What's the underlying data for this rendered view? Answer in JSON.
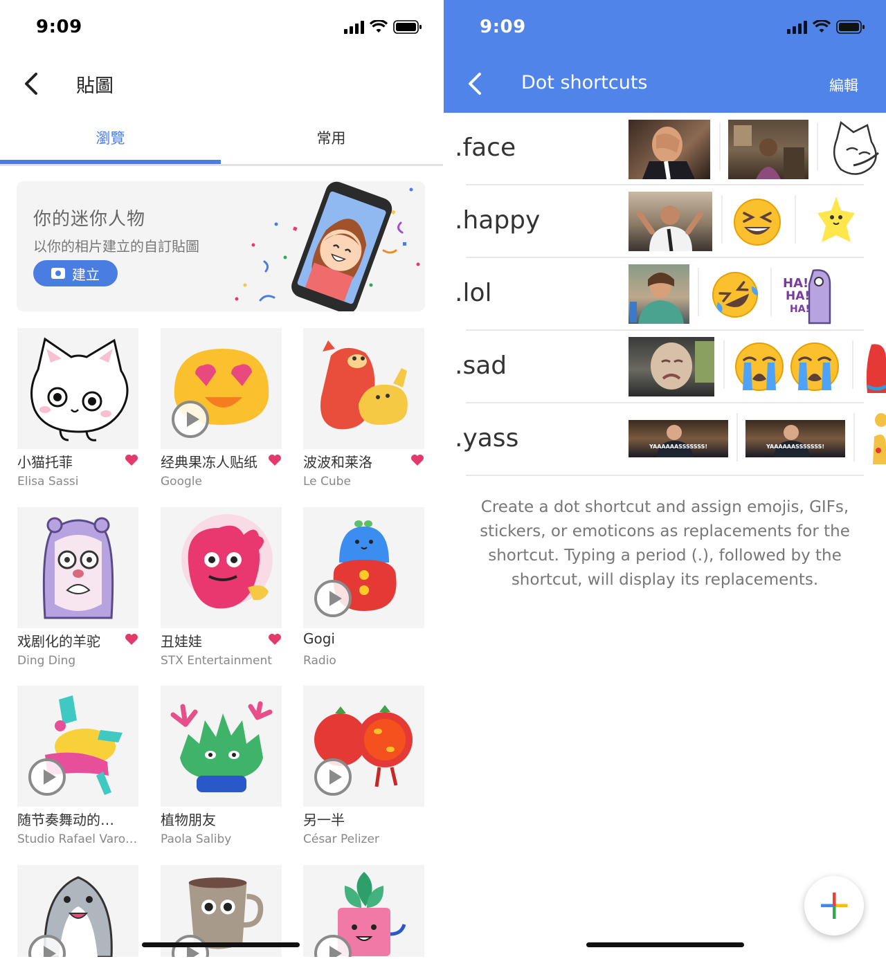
{
  "left": {
    "status": {
      "time": "9:09"
    },
    "header": {
      "title": "貼圖"
    },
    "tabs": [
      {
        "label": "瀏覽",
        "active": true
      },
      {
        "label": "常用",
        "active": false
      }
    ],
    "banner": {
      "title": "你的迷你人物",
      "subtitle": "以你的相片建立的自訂貼圖",
      "button_label": "建立"
    },
    "stickers": [
      {
        "name": "小猫托菲",
        "author": "Elisa Sassi",
        "favorite": true,
        "animated": false
      },
      {
        "name": "经典果冻人贴纸",
        "author": "Google",
        "favorite": true,
        "animated": true
      },
      {
        "name": "波波和莱洛",
        "author": "Le Cube",
        "favorite": true,
        "animated": false
      },
      {
        "name": "戏剧化的羊驼",
        "author": "Ding Ding",
        "favorite": true,
        "animated": false
      },
      {
        "name": "丑娃娃",
        "author": "STX Entertainment",
        "favorite": true,
        "animated": false
      },
      {
        "name": "Gogi",
        "author": "Radio",
        "favorite": false,
        "animated": true
      },
      {
        "name": "随节奏舞动的…",
        "author": "Studio Rafael Varo…",
        "favorite": false,
        "animated": true
      },
      {
        "name": "植物朋友",
        "author": "Paola Saliby",
        "favorite": false,
        "animated": false
      },
      {
        "name": "另一半",
        "author": "César Pelizer",
        "favorite": false,
        "animated": true
      },
      {
        "name": "",
        "author": "",
        "favorite": false,
        "animated": true
      },
      {
        "name": "",
        "author": "",
        "favorite": false,
        "animated": true
      },
      {
        "name": "",
        "author": "",
        "favorite": false,
        "animated": true
      }
    ],
    "colors": {
      "accent": "#4a7de2",
      "heart": "#e23a6b"
    }
  },
  "right": {
    "status": {
      "time": "9:09"
    },
    "header": {
      "title": "Dot shortcuts",
      "edit_label": "編輯"
    },
    "shortcuts": [
      {
        "label": ".face",
        "replacements": [
          "gif-facepalm",
          "gif-girl",
          "sticker-cat-facepalm"
        ]
      },
      {
        "label": ".happy",
        "replacements": [
          "gif-celebrate",
          "emoji-grinning-squinting",
          "sticker-yellow-star"
        ]
      },
      {
        "label": ".lol",
        "replacements": [
          "gif-laughing",
          "emoji-rolling-on-floor-laughing",
          "sticker-haha"
        ]
      },
      {
        "label": ".sad",
        "replacements": [
          "gif-crying-baby",
          "emoji-loudly-crying",
          "emoji-loudly-crying"
        ]
      },
      {
        "label": ".yass",
        "replacements": [
          "gif-yaaass",
          "gif-yaaass"
        ],
        "caption": "YAAAAAASSSSSSS!"
      }
    ],
    "description": "Create a dot shortcut and assign emojis, GIFs, stickers, or emoticons as replacements for the shortcut. Typing a period (.), followed by the shortcut, will display its replacements.",
    "colors": {
      "bar": "#5184e8"
    }
  }
}
